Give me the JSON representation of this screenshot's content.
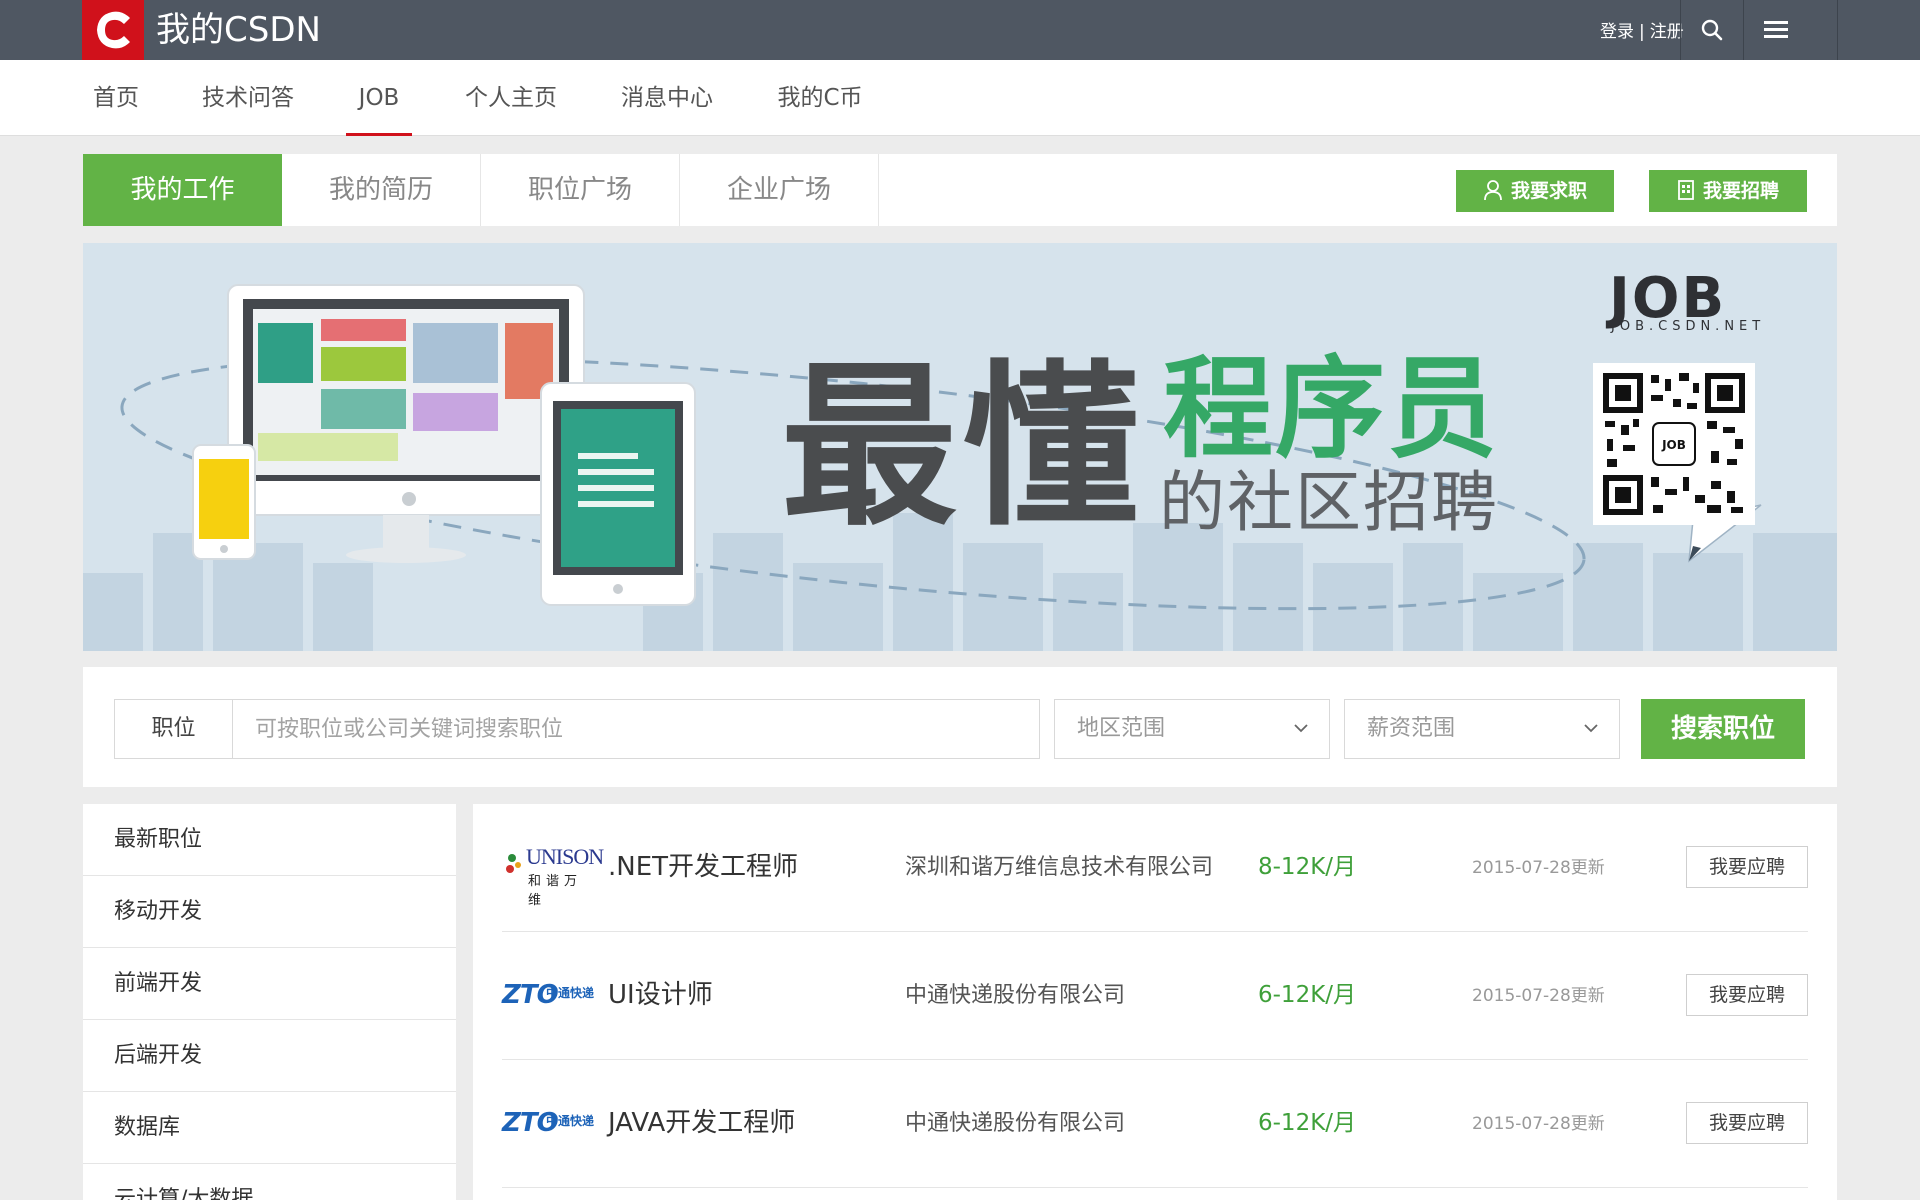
{
  "topbar": {
    "brand": "我的CSDN",
    "login": "登录",
    "separator": "|",
    "register": "注册",
    "icons": [
      "search-icon",
      "menu-icon"
    ]
  },
  "nav": {
    "items": [
      "首页",
      "技术问答",
      "JOB",
      "个人主页",
      "消息中心",
      "我的C币"
    ],
    "active": "JOB"
  },
  "subtabs": {
    "items": [
      "我的工作",
      "我的简历",
      "职位广场",
      "企业广场"
    ],
    "active": "我的工作",
    "seek_job": "我要求职",
    "recruit": "我要招聘"
  },
  "banner": {
    "headline": "最懂",
    "highlight": "程序员",
    "subline": "的社区招聘",
    "logo": "JOB",
    "logo_url": "JOB.CSDN.NET",
    "qr_label": "JOB"
  },
  "search": {
    "label": "职位",
    "placeholder": "可按职位或公司关键词搜索职位",
    "region": "地区范围",
    "salary": "薪资范围",
    "button": "搜索职位"
  },
  "sidebar": {
    "items": [
      "最新职位",
      "移动开发",
      "前端开发",
      "后端开发",
      "数据库",
      "云计算/大数据"
    ]
  },
  "jobs": [
    {
      "logo": "UNISON 和谐万维",
      "logo_text": "UNISON",
      "logo_cn": "和谐万维",
      "title": ".NET开发工程师",
      "company": "深圳和谐万维信息技术有限公司",
      "salary": "8-12K/月",
      "date": "2015-07-28更新",
      "action": "我要应聘"
    },
    {
      "logo": "ZTO 中通快递",
      "logo_text": "ZTO",
      "logo_cn": "中通快递",
      "title": "UI设计师",
      "company": "中通快递股份有限公司",
      "salary": "6-12K/月",
      "date": "2015-07-28更新",
      "action": "我要应聘"
    },
    {
      "logo": "ZTO 中通快递",
      "logo_text": "ZTO",
      "logo_cn": "中通快递",
      "title": "JAVA开发工程师",
      "company": "中通快递股份有限公司",
      "salary": "6-12K/月",
      "date": "2015-07-28更新",
      "action": "我要应聘"
    }
  ],
  "colors": {
    "topbar": "#4f5762",
    "brand_red": "#d0111b",
    "accent_green": "#62b346",
    "salary_green": "#3fa03a"
  }
}
